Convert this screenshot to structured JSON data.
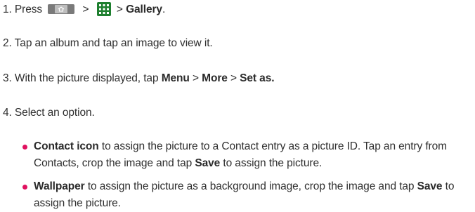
{
  "step1": {
    "prefix": "1. Press",
    "sep1": ">",
    "sep2": "> ",
    "app_name": "Gallery",
    "suffix": "."
  },
  "step2": {
    "text": "2. Tap an album and tap an image to view it."
  },
  "step3": {
    "prefix": "3. With the picture displayed, tap ",
    "menu": "Menu",
    "sep1": " > ",
    "more": "More",
    "sep2": " > ",
    "set_as": "Set as."
  },
  "step4": {
    "text": "4. Select an option."
  },
  "options": [
    {
      "label": "Contact icon",
      "text1": " to assign the picture to a Contact entry as a picture ID. Tap an entry from Contacts, crop the image and tap ",
      "action": "Save",
      "text2": " to assign the picture."
    },
    {
      "label": "Wallpaper",
      "text1": " to assign the picture as a background image, crop the image and tap ",
      "action": "Save",
      "text2": " to assign the picture."
    }
  ],
  "icons": {
    "home_key": "home-key-icon",
    "apps_key": "apps-grid-icon"
  },
  "colors": {
    "bullet": "#e0115f",
    "apps_grid": "#1e7f2f"
  }
}
